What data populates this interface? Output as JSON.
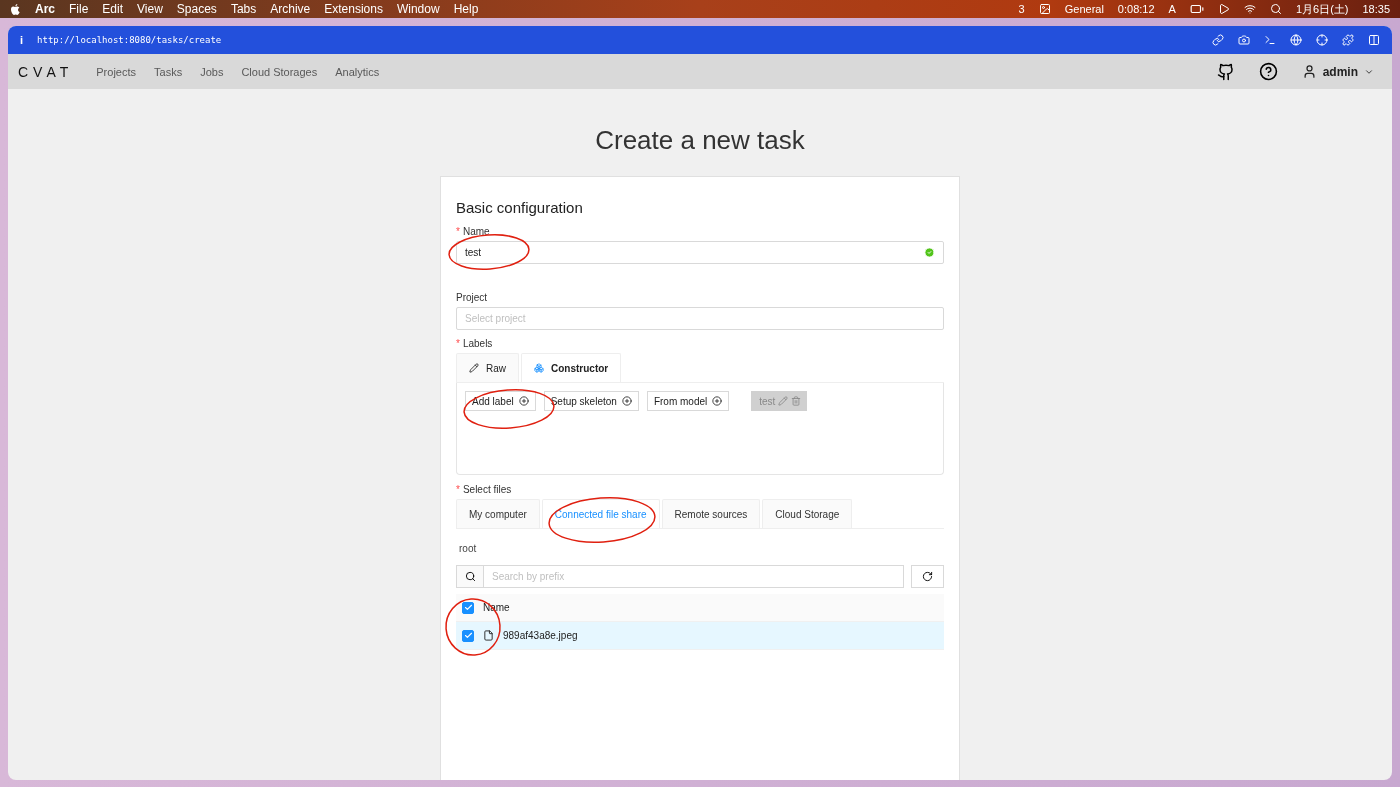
{
  "menubar": {
    "menus": [
      {
        "label": "Arc",
        "bold": true
      },
      {
        "label": "File",
        "bold": false
      },
      {
        "label": "Edit",
        "bold": false
      },
      {
        "label": "View",
        "bold": false
      },
      {
        "label": "Spaces",
        "bold": false
      },
      {
        "label": "Tabs",
        "bold": false
      },
      {
        "label": "Archive",
        "bold": false
      },
      {
        "label": "Extensions",
        "bold": false
      },
      {
        "label": "Window",
        "bold": false
      },
      {
        "label": "Help",
        "bold": false
      }
    ],
    "badge": "3",
    "focus": "General",
    "timer": "0:08:12",
    "input_mode": "A",
    "date": "1月6日(土)",
    "time": "18:35"
  },
  "browser": {
    "info": "i",
    "url": "http://localhost:8080/tasks/create"
  },
  "header": {
    "logo": "CVAT",
    "nav": [
      "Projects",
      "Tasks",
      "Jobs",
      "Cloud Storages",
      "Analytics"
    ],
    "user": "admin"
  },
  "page_title": "Create a new task",
  "form": {
    "section": "Basic configuration",
    "name": {
      "label": "Name",
      "marker": "*",
      "value": "test",
      "valid": true
    },
    "project": {
      "label": "Project",
      "placeholder": "Select project"
    },
    "labels": {
      "label": "Labels",
      "marker": "*",
      "tabs": [
        {
          "label": "Raw",
          "selected": false,
          "kind": "pencil"
        },
        {
          "label": "Constructor",
          "selected": true,
          "kind": "blocks"
        }
      ],
      "actions": [
        "Add label",
        "Setup skeleton",
        "From model"
      ],
      "items": [
        "test"
      ]
    },
    "files": {
      "label": "Select files",
      "marker": "*",
      "tabs": [
        {
          "label": "My computer",
          "selected": false
        },
        {
          "label": "Connected file share",
          "selected": true
        },
        {
          "label": "Remote sources",
          "selected": false
        },
        {
          "label": "Cloud Storage",
          "selected": false
        }
      ],
      "path": "root",
      "search_placeholder": "Search by prefix",
      "header": {
        "label": "Name",
        "checked": true
      },
      "rows": [
        {
          "name": "989af43a8e.jpeg",
          "checked": true,
          "selected": true
        }
      ]
    }
  }
}
